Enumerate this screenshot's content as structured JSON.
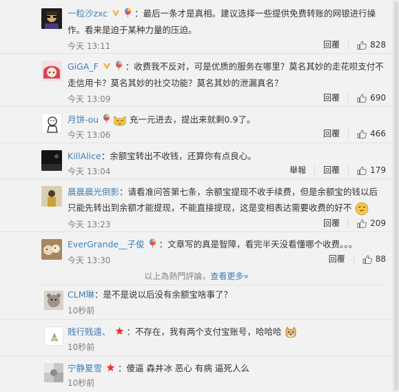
{
  "comments": [
    {
      "user": "一粒沙zxc",
      "text": "：最后一条才是真相。建议选择一些提供免费转账的网银进行操作。看来是迫于某种力量的压迫。",
      "time": "今天 13:11",
      "reply": "回覆",
      "likes": "828"
    },
    {
      "user": "GiGA_F",
      "text": "：收费我不反对，可是优质的服务在哪里？莫名其妙的走花呗支付不走信用卡？莫名其妙的社交功能？莫名其妙的泄漏真名？",
      "time": "今天 13:09",
      "reply": "回覆",
      "likes": "690"
    },
    {
      "user": "月饼-ou",
      "text": "充一元进去，提出来就剩0.9了。",
      "time": "今天 13:06",
      "reply": "回覆",
      "likes": "466"
    },
    {
      "user": "KillAlice",
      "text": "：余额宝转出不收钱，还算你有点良心。",
      "time": "今天 13:04",
      "report": "舉報",
      "reply": "回覆",
      "likes": "179"
    },
    {
      "user": "晨晨晨光倒影",
      "text": "：请看准问答第七条，余额宝提现不收手续费，但是余额宝的钱以后只能先转出到余额才能提现，不能直接提现，这是变相表达需要收费的好不",
      "time": "今天 13:23",
      "reply": "回覆",
      "likes": "209"
    },
    {
      "user": "EverGrande__子俊",
      "text": "：文章写的真是智障，看完半天没看懂哪个收费。。。",
      "time": "今天 13:30",
      "reply": "回覆",
      "likes": "88"
    }
  ],
  "more": {
    "prefix": "以上為熱門評論，",
    "link": "查看更多»"
  },
  "recent": [
    {
      "user": "CLM琳",
      "text": "：是不是说以后没有余额宝啥事了？",
      "time": "10秒前"
    },
    {
      "user": "贱行贱遠、",
      "text": "：不存在，我有两个支付宝账号，哈哈哈",
      "time": "10秒前"
    },
    {
      "user": "宁静夏雪",
      "text": "：傻逼 森井冰 恶心 有病 逼死人么",
      "time": "10秒前"
    }
  ],
  "colors": {
    "username_orange": "#eb7350",
    "username_blue": "#3f7fb6",
    "time_gray": "#808080",
    "background": "#f2f2f2"
  }
}
